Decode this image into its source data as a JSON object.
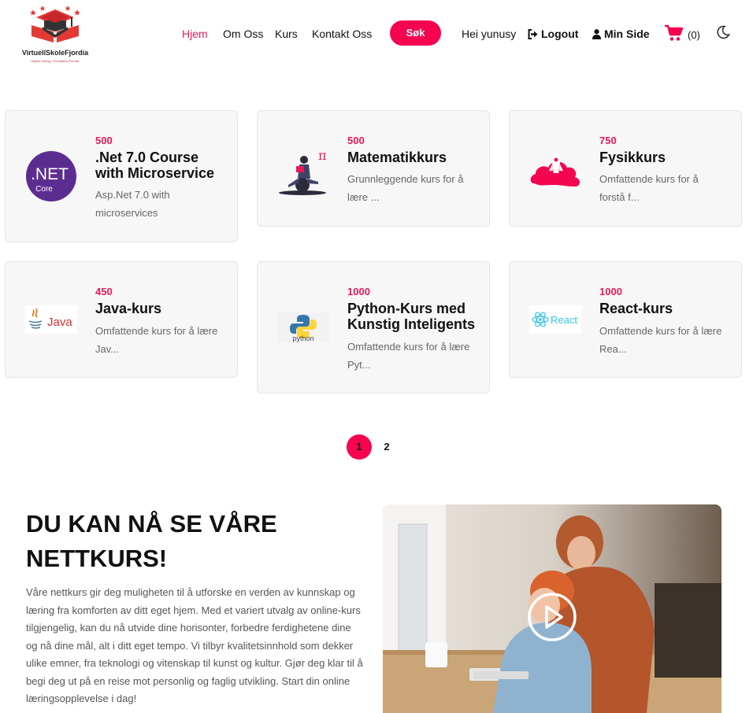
{
  "brand": {
    "name": "VirtuellSkoleFjordia",
    "tagline": "Digital Læring, Fremtidens Format"
  },
  "nav": {
    "home": "Hjem",
    "about": "Om Oss",
    "courses": "Kurs",
    "contact": "Kontakt Oss",
    "search_label": "Søk",
    "greeting": "Hei yunusy",
    "logout": "Logout",
    "my_page": "Min Side",
    "cart_count": "(0)"
  },
  "courses": [
    {
      "price": "500",
      "title": ".Net 7.0 Course with Microservice",
      "desc": "Asp.Net 7.0 with microservices",
      "icon": "dotnet-core-logo"
    },
    {
      "price": "500",
      "title": "Matematikkurs",
      "desc": "Grunnleggende kurs for å lære ...",
      "icon": "math-student-illustration"
    },
    {
      "price": "750",
      "title": "Fysikkurs",
      "desc": "Omfattende kurs for å forstå f...",
      "icon": "rocket-launch-icon"
    },
    {
      "price": "450",
      "title": "Java-kurs",
      "desc": "Omfattende kurs for å lære Jav...",
      "icon": "java-logo"
    },
    {
      "price": "1000",
      "title": "Python-Kurs med Kunstig Inteligents",
      "desc": "Omfattende kurs for å lære Pyt...",
      "icon": "python-logo"
    },
    {
      "price": "1000",
      "title": "React-kurs",
      "desc": "Omfattende kurs for å lære Rea...",
      "icon": "react-logo"
    }
  ],
  "dotnet_logo": {
    "line1": ".NET",
    "line2": "Core"
  },
  "java_logo": "Java",
  "python_logo": "python",
  "react_logo": "React",
  "pagination": {
    "page1": "1",
    "page2": "2",
    "current": "1"
  },
  "promo": {
    "title": "DU KAN NÅ SE VÅRE NETTKURS!",
    "text": "Våre nettkurs gir deg muligheten til å utforske en verden av kunnskap og læring fra komforten av ditt eget hjem. Med et variert utvalg av online-kurs tilgjengelig, kan du nå utvide dine horisonter, forbedre ferdighetene dine og nå dine mål, alt i ditt eget tempo. Vi tilbyr kvalitetsinnhold som dekker ulike emner, fra teknologi og vitenskap til kunst og kultur. Gjør deg klar til å begi deg ut på en reise mot personlig og faglig utvikling. Start din online læringsopplevelse i dag!"
  },
  "colors": {
    "accent": "#f5044f",
    "price": "#e8195a",
    "dotnet": "#5c2d91"
  }
}
